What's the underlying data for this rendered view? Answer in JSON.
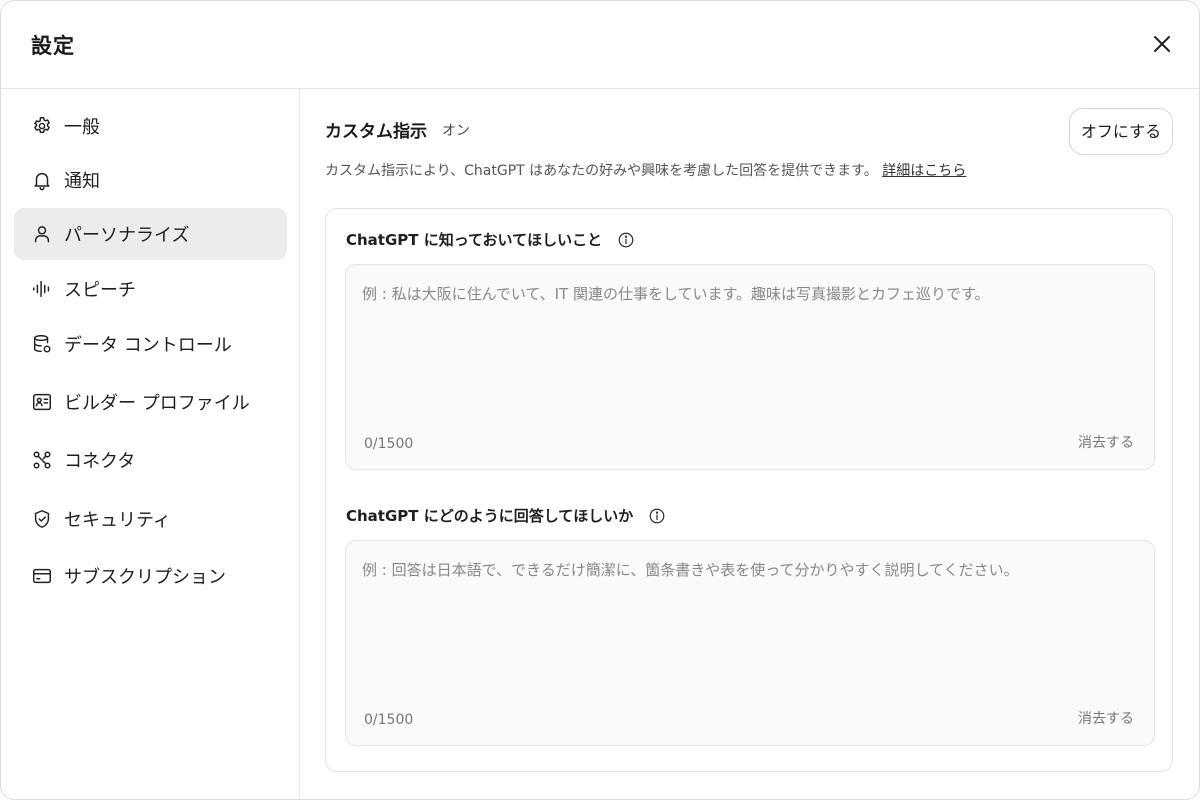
{
  "dialog": {
    "title": "設定"
  },
  "sidebar": {
    "items": [
      {
        "label": "一般",
        "icon": "gear-icon",
        "active": false
      },
      {
        "label": "通知",
        "icon": "bell-icon",
        "active": false
      },
      {
        "label": "パーソナライズ",
        "icon": "person-icon",
        "active": true
      },
      {
        "label": "スピーチ",
        "icon": "waveform-icon",
        "active": false
      },
      {
        "label": "データ コントロール",
        "icon": "database-icon",
        "active": false
      },
      {
        "label": "ビルダー プロファイル",
        "icon": "id-card-icon",
        "active": false
      },
      {
        "label": "コネクタ",
        "icon": "connector-icon",
        "active": false
      },
      {
        "label": "セキュリティ",
        "icon": "shield-icon",
        "active": false
      },
      {
        "label": "サブスクリプション",
        "icon": "credit-card-icon",
        "active": false
      }
    ]
  },
  "main": {
    "section_title": "カスタム指示",
    "section_status": "オン",
    "off_button_label": "オフにする",
    "description": "カスタム指示により、ChatGPT はあなたの好みや興味を考慮した回答を提供できます。",
    "details_link": "詳細はこちら",
    "fields": [
      {
        "label": "ChatGPT に知っておいてほしいこと",
        "value": "",
        "placeholder": "例 : 私は大阪に住んでいて、IT 関連の仕事をしています。趣味は写真撮影とカフェ巡りです。",
        "counter": "0/1500",
        "clear_label": "消去する"
      },
      {
        "label": "ChatGPT にどのように回答してほしいか",
        "value": "",
        "placeholder": "例 : 回答は日本語で、できるだけ簡潔に、箇条書きや表を使って分かりやすく説明してください。",
        "counter": "0/1500",
        "clear_label": "消去する"
      }
    ]
  },
  "colors": {
    "active_nav_bg": "#ececec",
    "border": "#e4e4e4",
    "text_primary": "#1f1f1f",
    "text_muted": "#777777"
  }
}
